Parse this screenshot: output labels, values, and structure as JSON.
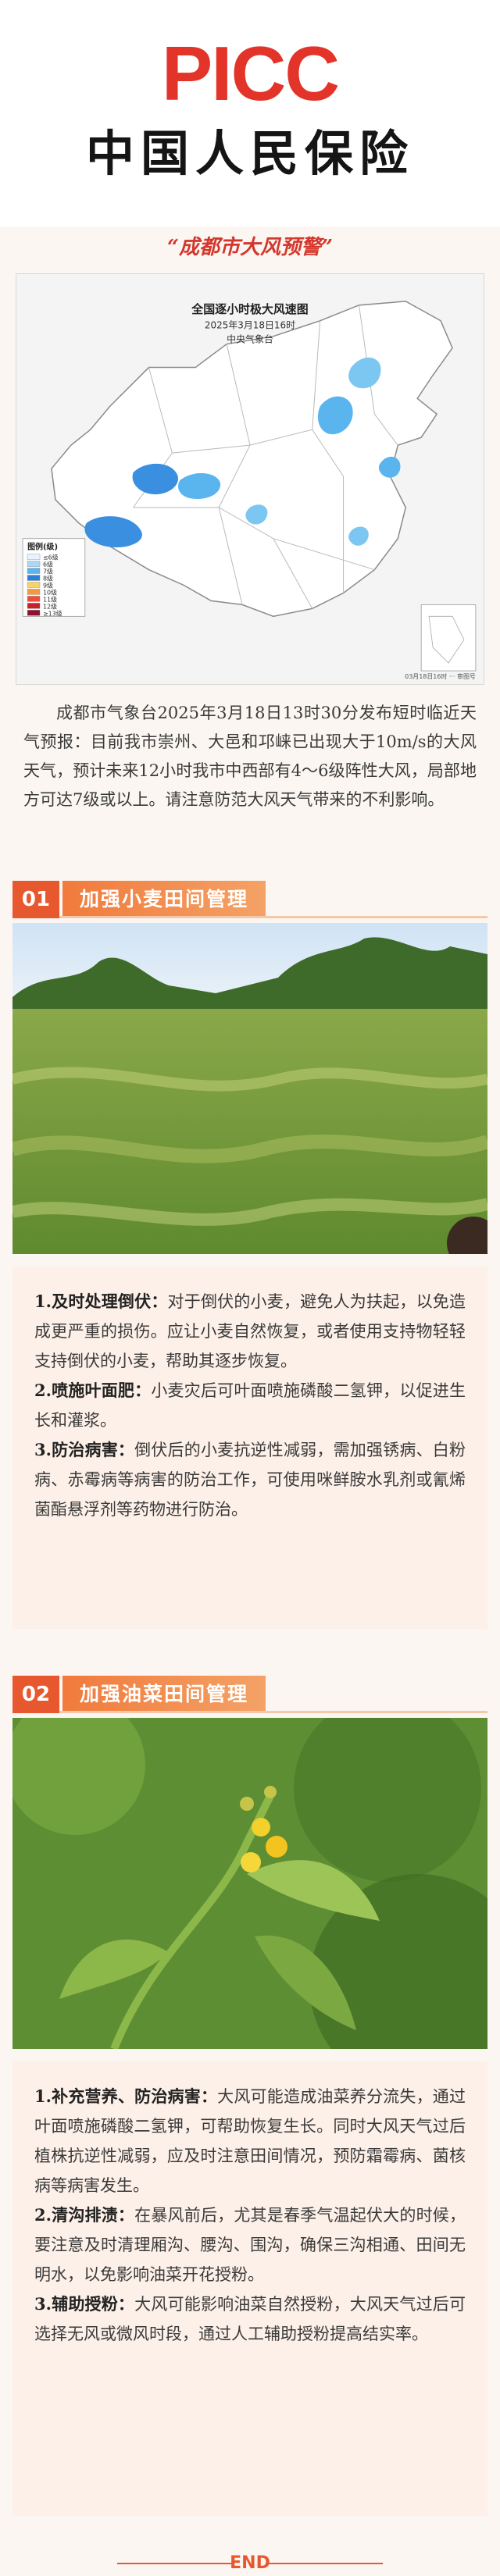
{
  "header": {
    "logo": "PICC",
    "brand_name": "中国人民保险",
    "alert_title": "“成都市大风预警”"
  },
  "map": {
    "title": "全国逐小时极大风速图",
    "date": "2025年3月18日16时",
    "agency": "中央气象台",
    "legend_title": "图例(级)",
    "legend_items": [
      {
        "label": "≤6级",
        "color": "#e8f3ff"
      },
      {
        "label": "6级",
        "color": "#a8d8f8"
      },
      {
        "label": "7级",
        "color": "#5ab4ee"
      },
      {
        "label": "8级",
        "color": "#2f7fd2"
      },
      {
        "label": "9级",
        "color": "#f8d36a"
      },
      {
        "label": "10级",
        "color": "#f59a3a"
      },
      {
        "label": "11级",
        "color": "#ee4d3a"
      },
      {
        "label": "12级",
        "color": "#c8202b"
      },
      {
        "label": "≥13级",
        "color": "#8e1230"
      }
    ],
    "footer": "03月18日16时 ··· 审图号"
  },
  "intro": "成都市气象台2025年3月18日13时30分发布短时临近天气预报：目前我市崇州、大邑和邛崃已出现大于10m/s的大风天气，预计未来12小时我市中西部有4～6级阵性大风，局部地方可达7级或以上。请注意防范大风天气带来的不利影响。",
  "sections": [
    {
      "num": "01",
      "title": "加强小麦田间管理",
      "items": [
        {
          "head": "1.及时处理倒伏：",
          "body": "对于倒伏的小麦，避免人为扶起，以免造成更严重的损伤。应让小麦自然恢复，或者使用支持物轻轻支持倒伏的小麦，帮助其逐步恢复。"
        },
        {
          "head": "2.喷施叶面肥：",
          "body": "小麦灾后可叶面喷施磷酸二氢钾，以促进生长和灌浆。"
        },
        {
          "head": "3.防治病害：",
          "body": "倒伏后的小麦抗逆性减弱，需加强锈病、白粉病、赤霉病等病害的防治工作，可使用咪鲜胺水乳剂或氰烯菌酯悬浮剂等药物进行防治。"
        }
      ]
    },
    {
      "num": "02",
      "title": "加强油菜田间管理",
      "items": [
        {
          "head": "1.补充营养、防治病害：",
          "body": "大风可能造成油菜养分流失，通过叶面喷施磷酸二氢钾，可帮助恢复生长。同时大风天气过后植株抗逆性减弱，应及时注意田间情况，预防霜霉病、菌核病等病害发生。"
        },
        {
          "head": "2.清沟排渍：",
          "body": "在暴风前后，尤其是春季气温起伏大的时候，要注意及时清理厢沟、腰沟、围沟，确保三沟相通、田间无明水，以免影响油菜开花授粉。"
        },
        {
          "head": "3.辅助授粉：",
          "body": "大风可能影响油菜自然授粉，大风天气过后可选择无风或微风时段，通过人工辅助授粉提高结实率。"
        }
      ]
    }
  ],
  "end_text": "END"
}
